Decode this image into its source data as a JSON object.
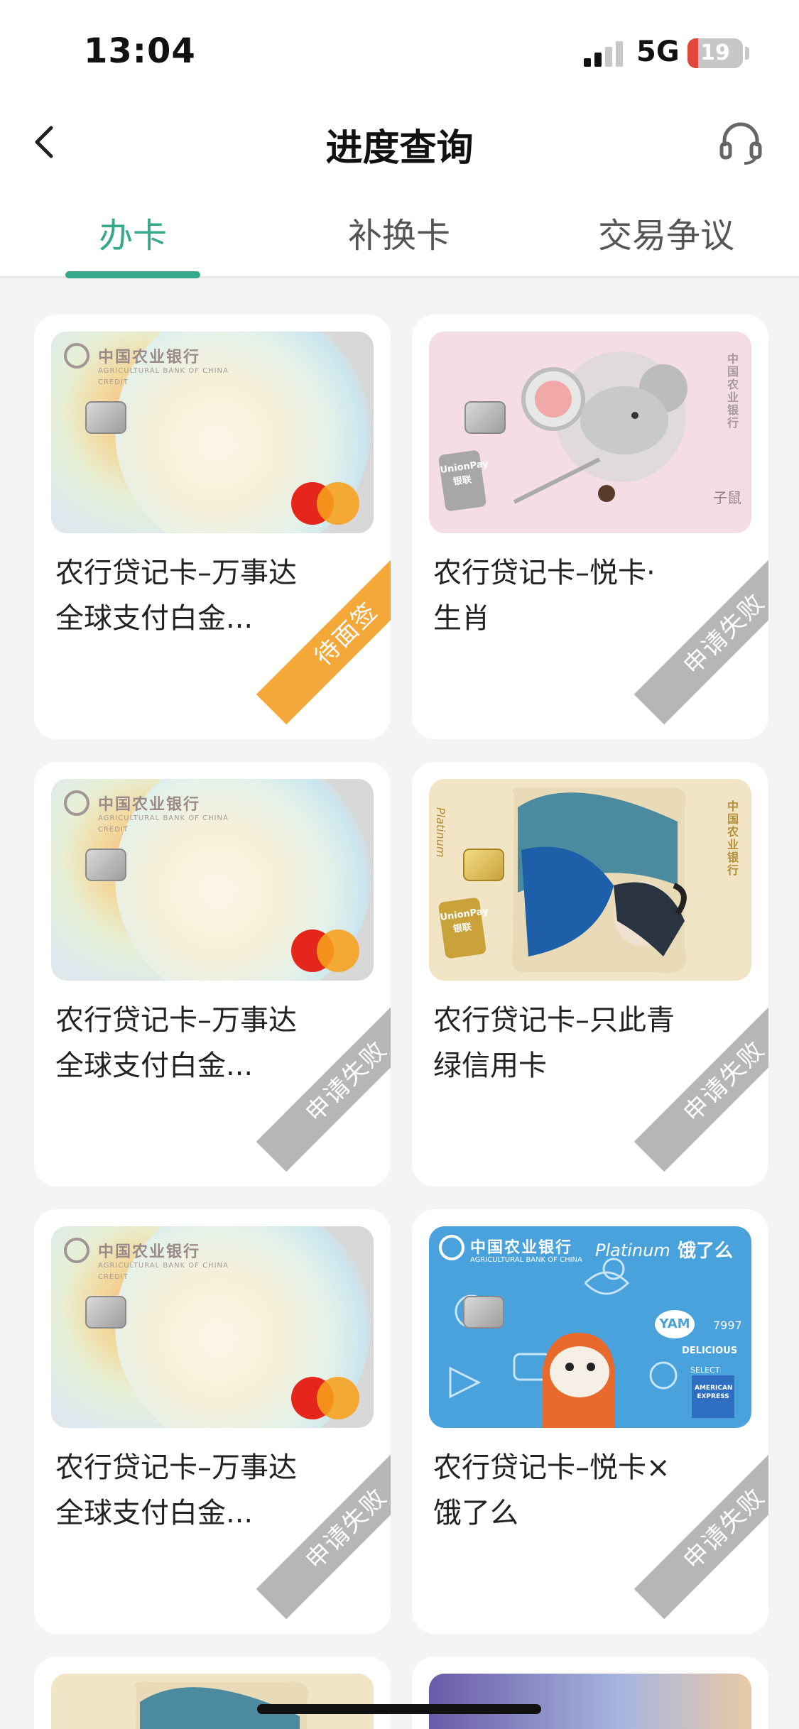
{
  "status_bar": {
    "time": "13:04",
    "network": "5G",
    "battery": "19",
    "battery_level": 0.19
  },
  "nav": {
    "title": "进度查询",
    "back_icon": "chevron-left-icon",
    "service_icon": "headset-icon"
  },
  "tabs": [
    {
      "label": "办卡",
      "active": true
    },
    {
      "label": "补换卡",
      "active": false
    },
    {
      "label": "交易争议",
      "active": false
    }
  ],
  "colors": {
    "accent": "#35a98a",
    "ribbon_pending": "#f5a83a",
    "ribbon_failed": "#b6b6b6"
  },
  "cards": [
    {
      "name_line1": "农行贷记卡–万事达",
      "name_line2": "全球支付白金...",
      "status": "待面签",
      "art": "mastercard-platinum"
    },
    {
      "name_line1": "农行贷记卡–悦卡·",
      "name_line2": "生肖",
      "status": "申请失败",
      "art": "zodiac-rat"
    },
    {
      "name_line1": "农行贷记卡–万事达",
      "name_line2": "全球支付白金...",
      "status": "申请失败",
      "art": "mastercard-platinum"
    },
    {
      "name_line1": "农行贷记卡–只此青",
      "name_line2": "绿信用卡",
      "status": "申请失败",
      "art": "landscape-dancer"
    },
    {
      "name_line1": "农行贷记卡–万事达",
      "name_line2": "全球支付白金...",
      "status": "申请失败",
      "art": "mastercard-platinum"
    },
    {
      "name_line1": "农行贷记卡–悦卡×",
      "name_line2": "饿了么",
      "status": "申请失败",
      "art": "eleme-amex"
    }
  ],
  "card_art_text": {
    "bank_name": "中国农业银行",
    "bank_en": "AGRICULTURAL BANK OF CHINA",
    "credit": "CREDIT",
    "platinum": "Platinum",
    "unionpay": "UnionPay",
    "unionpay_cn": "银联",
    "zodiac": "子鼠",
    "eleme": "饿了么",
    "yam": "YAM",
    "number": "7997",
    "delicious": "DELICIOUS",
    "select": "SELECT",
    "amex": "AMERICAN EXPRESS"
  }
}
